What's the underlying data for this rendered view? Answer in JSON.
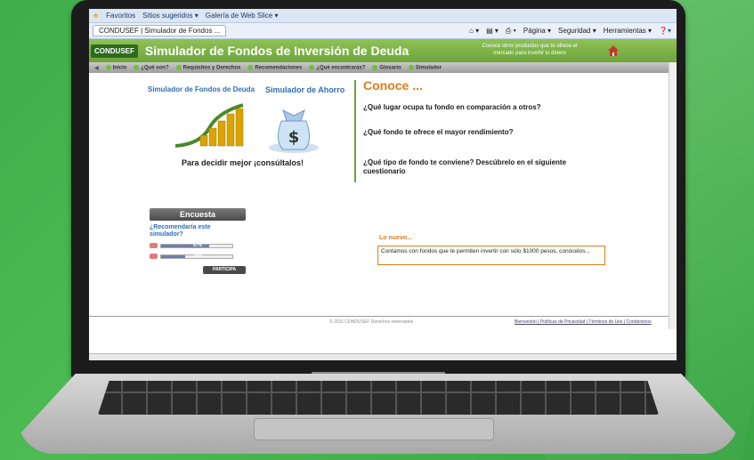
{
  "browser": {
    "favorites_label": "Favoritos",
    "suggested_sites": "Sitios sugeridos ▾",
    "web_slice": "Galería de Web Slice ▾",
    "tab_title": "CONDUSEF | Simulador de Fondos ...",
    "tools": [
      "Página ▾",
      "Seguridad ▾",
      "Herramientas ▾"
    ]
  },
  "site": {
    "logo": "CONDUSEF",
    "title": "Simulador de Fondos de Inversión de Deuda",
    "header_note": "Conoce otros productos que te ofrece el mercado para invertir tu dinero",
    "nav": [
      "Inicio",
      "¿Qué son?",
      "Requisitos y Derechos",
      "Recomendaciones",
      "¿Qué encontrarás?",
      "Glosario",
      "Simulador"
    ]
  },
  "left": {
    "sim_deuda": "Simulador de Fondos de Deuda",
    "sim_ahorro": "Simulador de Ahorro",
    "decide": "Para decidir mejor ¡consúltalos!"
  },
  "right": {
    "heading": "Conoce ...",
    "q1": "¿Qué lugar ocupa tu fondo en comparación a otros?",
    "q2": "¿Qué fondo te ofrece el mayor rendimiento?",
    "q3": "¿Qué tipo de fondo te conviene? Descúbrelo en el siguiente cuestionario"
  },
  "poll": {
    "button": "Encuesta",
    "question": "¿Recomendaría este simulador?",
    "yes_pct": 0.67,
    "no_pct": 0.34,
    "yes_label": "67%",
    "no_label": "34%",
    "submit": "PARTICIPA"
  },
  "news": {
    "label": "Lo nuevo...",
    "text": "Contamos con fondos que te permiten invertir con sólo $1000 pesos, conócelos..."
  },
  "footer": {
    "copyright": "© 2011 CONDUSEF Derechos reservados",
    "links": "Bienvenido | Políticas de Privacidad | Términos de Uso | Contáctenos"
  },
  "colors": {
    "header_green": "#6da43b",
    "accent_orange": "#e07b1a",
    "link_blue": "#2f6fb0"
  }
}
